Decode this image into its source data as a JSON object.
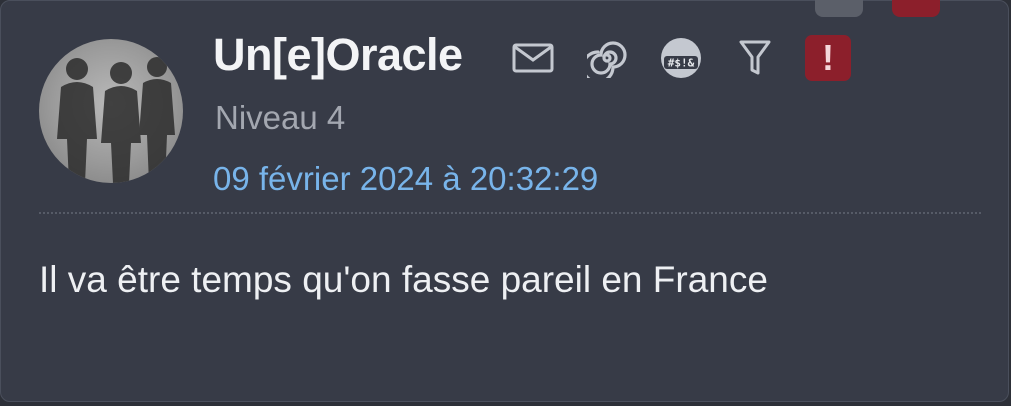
{
  "post": {
    "author": {
      "username": "Un[e]Oracle",
      "level": "Niveau 4"
    },
    "timestamp": "09 février 2024 à 20:32:29",
    "message": "Il va être temps qu'on fasse pareil en France",
    "actions": {
      "icons": [
        "mail-icon",
        "spiral-icon",
        "censored-emoji-icon",
        "filter-icon",
        "alert-icon"
      ],
      "censored_text": "#$!&",
      "alert_symbol": "!"
    }
  },
  "colors": {
    "card_background": "#373b47",
    "username": "#f3f4f6",
    "level_text": "#a3a7b0",
    "date_link": "#78b4ea",
    "message_text": "#eef0f3",
    "alert_background": "#8c1f2b"
  }
}
